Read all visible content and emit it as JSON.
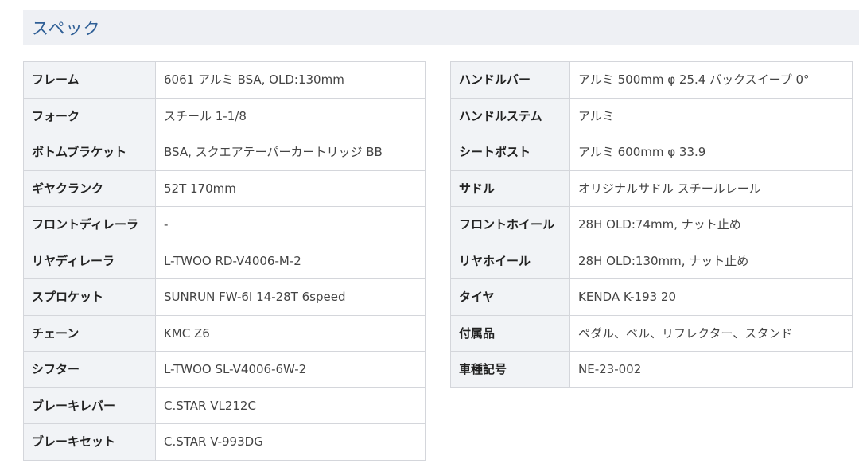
{
  "section": {
    "title": "スペック"
  },
  "spec_left": [
    {
      "label": "フレーム",
      "value": "6061 アルミ BSA, OLD:130mm"
    },
    {
      "label": "フォーク",
      "value": "スチール 1-1/8"
    },
    {
      "label": "ボトムブラケット",
      "value": "BSA, スクエアテーパーカートリッジ BB"
    },
    {
      "label": "ギヤクランク",
      "value": "52T 170mm"
    },
    {
      "label": "フロントディレーラ",
      "value": "-"
    },
    {
      "label": "リヤディレーラ",
      "value": "L-TWOO RD-V4006-M-2"
    },
    {
      "label": "スプロケット",
      "value": "SUNRUN FW-6I 14-28T 6speed"
    },
    {
      "label": "チェーン",
      "value": "KMC Z6"
    },
    {
      "label": "シフター",
      "value": "L-TWOO SL-V4006-6W-2"
    },
    {
      "label": "ブレーキレバー",
      "value": "C.STAR VL212C"
    },
    {
      "label": "ブレーキセット",
      "value": "C.STAR V-993DG"
    }
  ],
  "spec_right": [
    {
      "label": "ハンドルバー",
      "value": "アルミ 500mm φ 25.4 バックスイープ 0°"
    },
    {
      "label": "ハンドルステム",
      "value": "アルミ"
    },
    {
      "label": "シートポスト",
      "value": "アルミ 600mm φ 33.9"
    },
    {
      "label": "サドル",
      "value": "オリジナルサドル スチールレール"
    },
    {
      "label": "フロントホイール",
      "value": "28H OLD:74mm, ナット止め"
    },
    {
      "label": "リヤホイール",
      "value": "28H OLD:130mm, ナット止め"
    },
    {
      "label": "タイヤ",
      "value": "KENDA K-193 20"
    },
    {
      "label": "付属品",
      "value": "ペダル、ベル、リフレクター、スタンド"
    },
    {
      "label": "車種記号",
      "value": "NE-23-002"
    }
  ]
}
